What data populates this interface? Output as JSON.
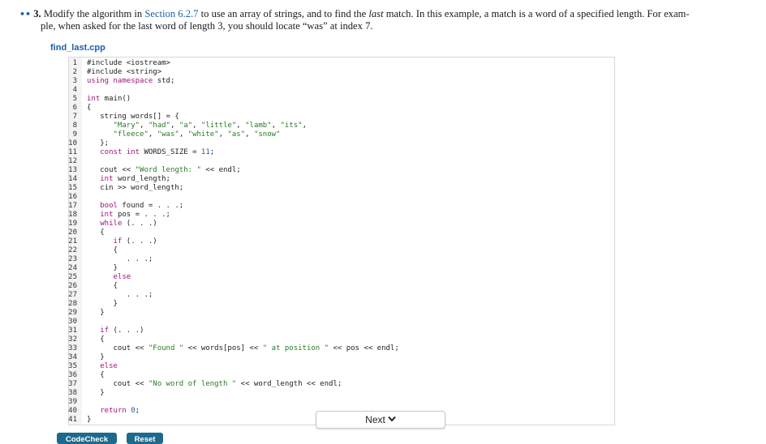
{
  "problem": {
    "dots": "••",
    "number": "3.",
    "text_before_link": "Modify the algorithm in ",
    "link": "Section 6.2.7",
    "text_after_link": " to use an array of strings, and to find the ",
    "emphasis": "last",
    "text_rest": " match. In this example, a match is a word of a specified length. For exam-",
    "text_line2": "ple, when asked for the last word of length 3, you should locate “was” at index 7."
  },
  "file": {
    "name": "find_last.cpp"
  },
  "code_lines": [
    {
      "n": "1",
      "t": "#include <iostream>"
    },
    {
      "n": "2",
      "t": "#include <string>"
    },
    {
      "n": "3",
      "t": "using namespace std;"
    },
    {
      "n": "4",
      "t": ""
    },
    {
      "n": "5",
      "t": "int main()"
    },
    {
      "n": "6",
      "t": "{"
    },
    {
      "n": "7",
      "t": "   string words[] = {"
    },
    {
      "n": "8",
      "t": "      \"Mary\", \"had\", \"a\", \"little\", \"lamb\", \"its\","
    },
    {
      "n": "9",
      "t": "      \"fleece\", \"was\", \"white\", \"as\", \"snow\""
    },
    {
      "n": "10",
      "t": "   };"
    },
    {
      "n": "11",
      "t": "   const int WORDS_SIZE = 11;"
    },
    {
      "n": "12",
      "t": ""
    },
    {
      "n": "13",
      "t": "   cout << \"Word length: \" << endl;"
    },
    {
      "n": "14",
      "t": "   int word_length;"
    },
    {
      "n": "15",
      "t": "   cin >> word_length;"
    },
    {
      "n": "16",
      "t": ""
    },
    {
      "n": "17",
      "t": "   bool found = . . .;"
    },
    {
      "n": "18",
      "t": "   int pos = . . .;"
    },
    {
      "n": "19",
      "t": "   while (. . .)"
    },
    {
      "n": "20",
      "t": "   {"
    },
    {
      "n": "21",
      "t": "      if (. . .)"
    },
    {
      "n": "22",
      "t": "      {"
    },
    {
      "n": "23",
      "t": "         . . .;"
    },
    {
      "n": "24",
      "t": "      }"
    },
    {
      "n": "25",
      "t": "      else"
    },
    {
      "n": "26",
      "t": "      {"
    },
    {
      "n": "27",
      "t": "         . . .;"
    },
    {
      "n": "28",
      "t": "      }"
    },
    {
      "n": "29",
      "t": "   }"
    },
    {
      "n": "30",
      "t": ""
    },
    {
      "n": "31",
      "t": "   if (. . .)"
    },
    {
      "n": "32",
      "t": "   {"
    },
    {
      "n": "33",
      "t": "      cout << \"Found \" << words[pos] << \" at position \" << pos << endl;"
    },
    {
      "n": "34",
      "t": "   }"
    },
    {
      "n": "35",
      "t": "   else"
    },
    {
      "n": "36",
      "t": "   {"
    },
    {
      "n": "37",
      "t": "      cout << \"No word of length \" << word_length << endl;"
    },
    {
      "n": "38",
      "t": "   }"
    },
    {
      "n": "39",
      "t": ""
    },
    {
      "n": "40",
      "t": "   return 0;"
    },
    {
      "n": "41",
      "t": "}"
    }
  ],
  "buttons": {
    "next": "Next",
    "codecheck": "CodeCheck",
    "reset": "Reset"
  },
  "icons": {
    "next_icon": "chevron-down-icon"
  }
}
